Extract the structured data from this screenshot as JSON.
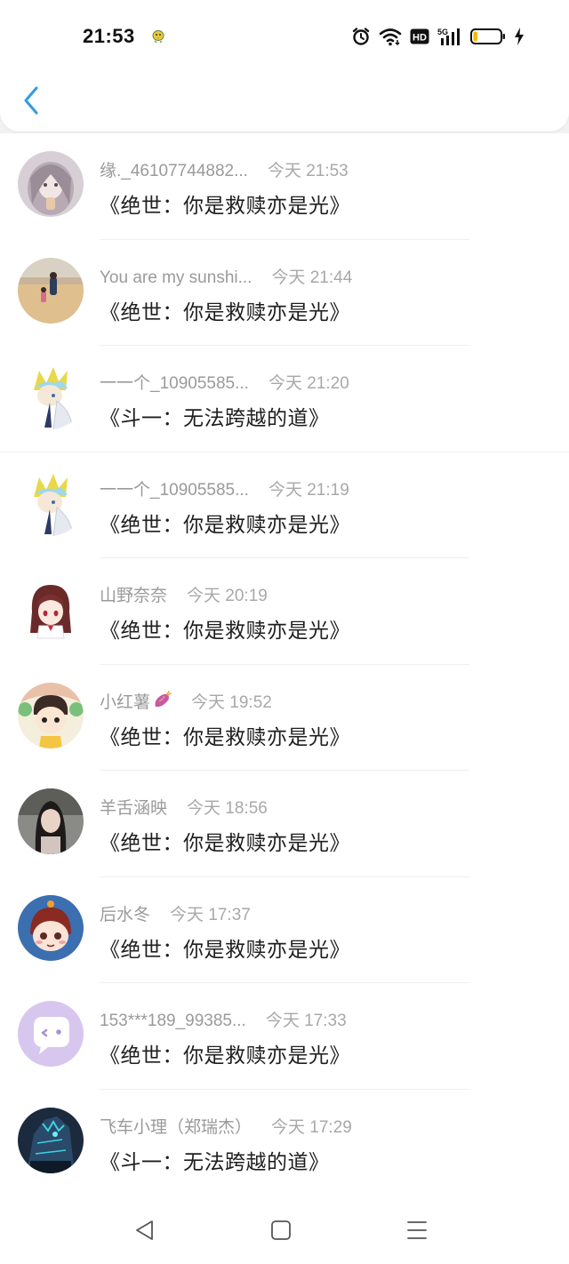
{
  "status_bar": {
    "time": "21:53",
    "indicators": [
      "chick-icon",
      "alarm-icon",
      "wifi-icon",
      "hd-icon",
      "signal-5g-icon",
      "battery-icon",
      "charging-icon"
    ],
    "network": "5G",
    "hd": "HD",
    "battery_level_percent": 15,
    "battery_color": "#f5b700"
  },
  "header": {
    "back_icon": "chevron-left-icon",
    "accent_color": "#2f9be8"
  },
  "rows": [
    {
      "name": "缘._46107744882...",
      "time": "今天 21:53",
      "message": "《绝世：你是救赎亦是光》"
    },
    {
      "name": "You are my sunshi...",
      "time": "今天 21:44",
      "message": "《绝世：你是救赎亦是光》"
    },
    {
      "name": "一一个_10905585...",
      "time": "今天 21:20",
      "message": "《斗一：无法跨越的道》"
    },
    {
      "name": "一一个_10905585...",
      "time": "今天 21:19",
      "message": "《绝世：你是救赎亦是光》"
    },
    {
      "name": "山野奈奈",
      "time": "今天 20:19",
      "message": "《绝世：你是救赎亦是光》"
    },
    {
      "name": "小红薯",
      "time": "今天 19:52",
      "message": "《绝世：你是救赎亦是光》",
      "name_emoji": "sweet-potato-icon"
    },
    {
      "name": "羊舌涵映",
      "time": "今天 18:56",
      "message": "《绝世：你是救赎亦是光》"
    },
    {
      "name": "后水冬",
      "time": "今天 17:37",
      "message": "《绝世：你是救赎亦是光》"
    },
    {
      "name": "153***189_99385...",
      "time": "今天 17:33",
      "message": "《绝世：你是救赎亦是光》"
    },
    {
      "name": "飞车小理（郑瑞杰）",
      "time": "今天 17:29",
      "message": "《斗一：无法跨越的道》"
    }
  ],
  "nav_bar": {
    "buttons": [
      "back-triangle-icon",
      "home-square-icon",
      "menu-lines-icon"
    ]
  }
}
